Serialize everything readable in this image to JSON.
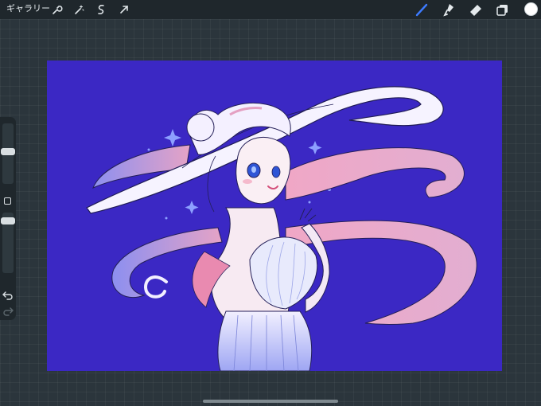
{
  "toolbar": {
    "gallery_label": "ギャラリー",
    "left_tools": [
      "wrench-icon",
      "magic-wand-icon",
      "selection-icon",
      "transform-arrow-icon"
    ],
    "right_tools": [
      "brush-icon",
      "smudge-icon",
      "eraser-icon",
      "layers-icon"
    ],
    "active_tool": "brush-icon",
    "active_tool_color": "#3d7bff",
    "current_color": "#ffffff"
  },
  "sidebar": {
    "brush_size": 0.45,
    "brush_opacity": 0.15,
    "buttons": [
      "modify-square-icon",
      "undo-icon",
      "redo-icon"
    ]
  },
  "canvas": {
    "artwork": "anime-girl-with-flowing-ribbon-illustration",
    "background_color": "#3b28c4"
  }
}
